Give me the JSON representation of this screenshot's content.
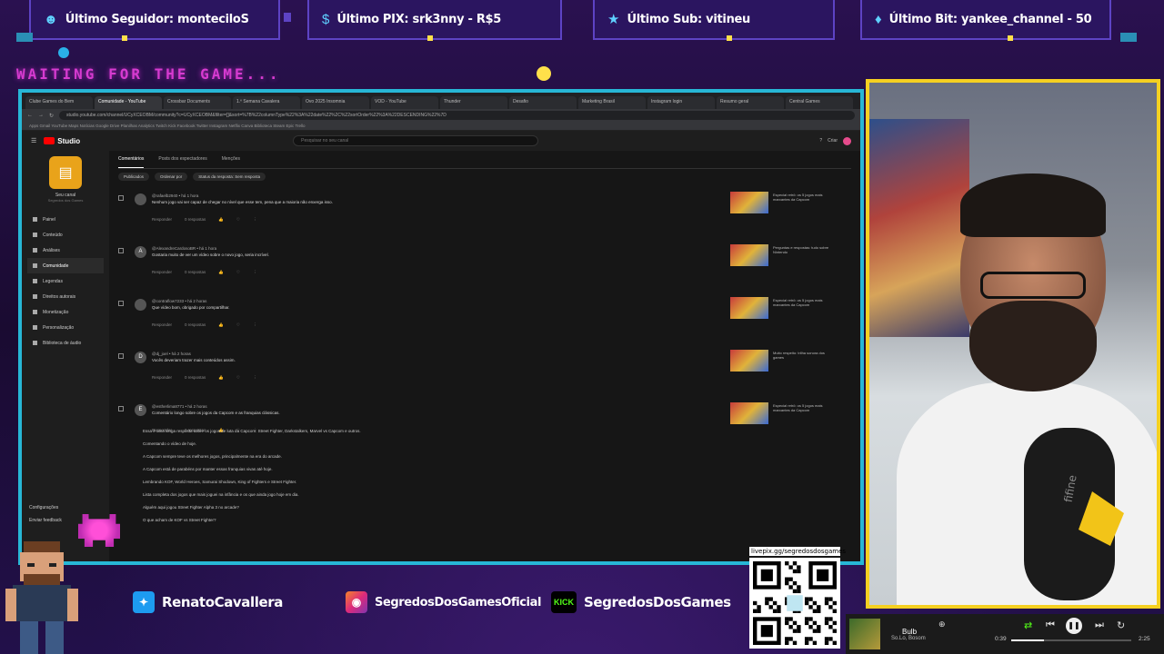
{
  "alerts": [
    {
      "icon": "person-icon",
      "label": "Último Seguidor: monteciloS"
    },
    {
      "icon": "dollar-icon",
      "label": "Último PIX: srk3nny - R$5"
    },
    {
      "icon": "star-icon",
      "label": "Último Sub: vitineu"
    },
    {
      "icon": "diamond-icon",
      "label": "Último Bit: yankee_channel - 50"
    }
  ],
  "waiting_text": "WAITING FOR THE GAME...",
  "browser": {
    "tabs": [
      "Clube Games do Bem",
      "Comunidade - YouTube",
      "Crossbar Documents",
      "1.º Semana Cavalera",
      "Ovo 2025 Insomnia",
      "VOD - YouTube",
      "Thunder",
      "Desafio",
      "Marketing Brasil",
      "Instagram login",
      "Resumo geral",
      "Central Games"
    ],
    "url": "studio.youtube.com/channel/UCyXCEOBM/community?c=UCyXCEOBM&filter=[]&sort=%7B%22columnType%22%3A%22date%22%2C%22sortOrder%22%3A%22DESCENDING%22%7D",
    "bookmarks": "Apps  Gmail  YouTube  Maps  Notícias  Google Drive  Planilhas  Analytics  Twitch  Kick  Facebook  Twitter  Instagram  Netflix  Canva  Biblioteca  Steam  Epic  Trello"
  },
  "studio": {
    "logo": "Studio",
    "search_placeholder": "Pesquisar no seu canal",
    "create_label": "Criar",
    "channel_name": "Seu canal",
    "channel_sub": "Segredos dos Games",
    "nav": [
      "Painel",
      "Conteúdo",
      "Análises",
      "Comunidade",
      "Legendas",
      "Direitos autorais",
      "Monetização",
      "Personalização",
      "Biblioteca de áudio"
    ],
    "settings_label": "Configurações",
    "feedback_label": "Enviar feedback",
    "subtabs": [
      "Comentários",
      "Posts dos espectadores",
      "Menções"
    ],
    "filters": [
      "Publicados",
      "Ordenar por",
      "Status da resposta: Sem resposta"
    ],
    "reply_label": "Responder",
    "replies_label": "0 respostas",
    "comments": [
      {
        "avatar": "",
        "meta": "@rafaelb2940 • há 1 hora",
        "text": "Nenhum jogo vai ser capaz de chegar no nível que esse tem, pena que a maioria não enxerga isso.",
        "video": "Especial retrô: os 5 jogos mais marcantes da Capcom"
      },
      {
        "avatar": "A",
        "meta": "@AlexandreCardosoBR • há 1 hora",
        "text": "Gostaria muito de ver um vídeo sobre o novo jogo, seria incrível.",
        "video": "Perguntas e respostas: tudo sobre Nintendo"
      },
      {
        "avatar": "",
        "meta": "@contraflow7233 • há 2 horas",
        "text": "Que vídeo bom, obrigado por compartilhar.",
        "video": "Especial retrô: os 5 jogos mais marcantes da Capcom"
      },
      {
        "avatar": "D",
        "meta": "@dj_joel • há 2 horas",
        "text": "Vocês deveriam trazer mais conteúdos assim.",
        "video": "Muito respeito: trilha sonora dos games"
      },
      {
        "avatar": "E",
        "meta": "@estherlima8771 • há 2 horas",
        "text": "Comentário longo sobre os jogos da Capcom e as franquias clássicas.",
        "video": "Especial retrô: os 5 jogos mais marcantes da Capcom"
      }
    ],
    "long_lines": [
      "Essa é uma longa resposta sobre os jogos de luta da Capcom: Street Fighter, Darkstalkers, Marvel vs Capcom e outros.",
      "Comentando o vídeo de hoje.",
      "A Capcom sempre teve os melhores jogos, principalmente na era do arcade.",
      "A Capcom está de parabéns por manter essas franquias vivas até hoje.",
      "Lembrando KOF, World Heroes, Samurai Shodown, King of Fighters e Street Fighter.",
      "Lista completa dos jogos que mais joguei na infância e os que ainda jogo hoje em dia.",
      "Alguém aqui jogou Street Fighter Alpha 3 no arcade?",
      "O que acham de KOF vs Street Fighter?"
    ]
  },
  "socials": [
    {
      "icon": "twitter-icon",
      "label": "RenatoCavallera"
    },
    {
      "icon": "instagram-icon",
      "label": "SegredosDosGamesOficial"
    },
    {
      "icon": "kick-icon",
      "icon_text": "KICK",
      "label": "SegredosDosGames"
    }
  ],
  "qr_url": "livepix.gg/segredosdosgames",
  "music": {
    "song": "Bulb",
    "artist": "So.Lo, Bosom",
    "elapsed": "0:39",
    "duration": "2:25",
    "progress": 0.27
  },
  "webcam": {
    "mic_brand": "fifine"
  },
  "colors": {
    "cam_border": "#f5d021",
    "frame_border": "#27b7d6",
    "alert_border": "#5d43c4",
    "waiting": "#d63bd0"
  }
}
